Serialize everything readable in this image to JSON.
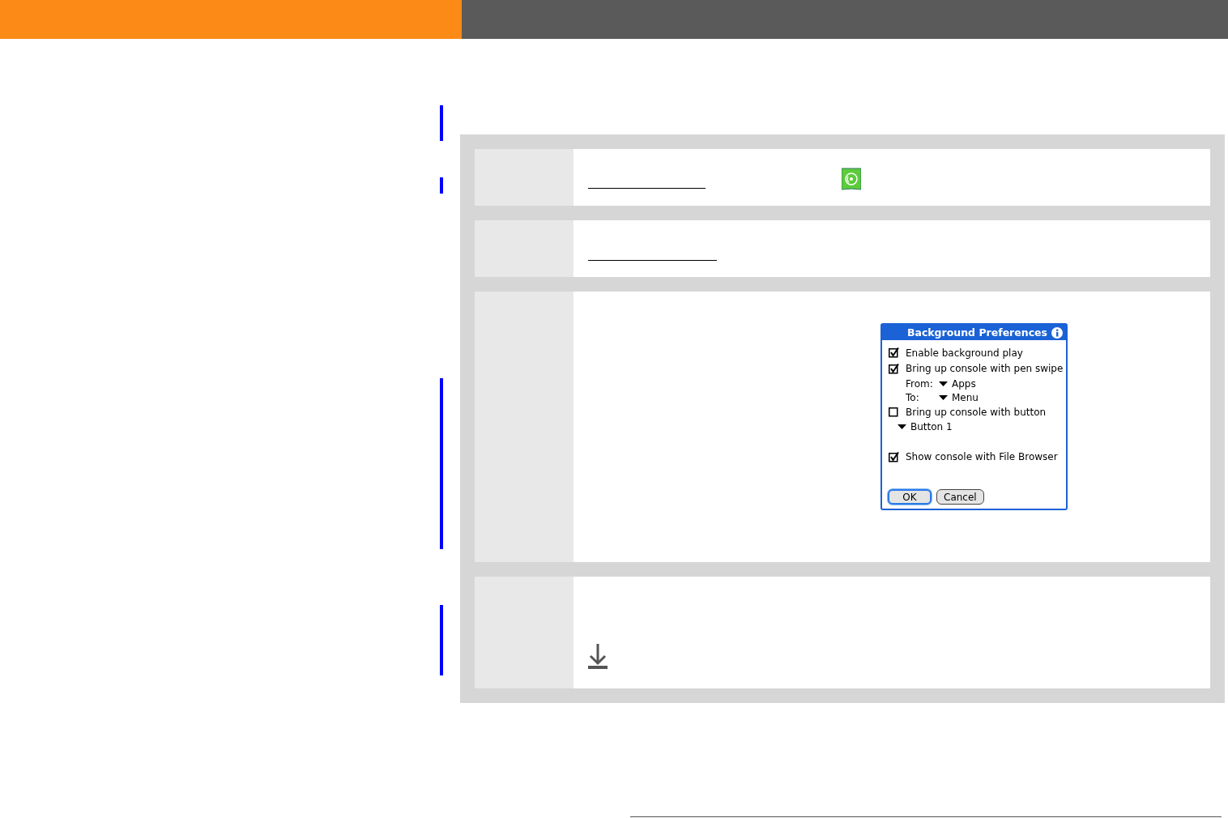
{
  "dialog": {
    "title": "Background Preferences",
    "items": [
      {
        "kind": "checkbox",
        "label": "Enable background play",
        "checked": true
      },
      {
        "kind": "checkbox",
        "label": "Bring up console with pen swipe",
        "checked": true
      },
      {
        "kind": "dropdown",
        "label": "From:",
        "value": "Apps"
      },
      {
        "kind": "dropdown",
        "label": "To:",
        "value": "Menu"
      },
      {
        "kind": "checkbox",
        "label": "Bring up console with button",
        "checked": false
      },
      {
        "kind": "dropdown",
        "value": "Button 1"
      },
      {
        "kind": "spacer"
      },
      {
        "kind": "checkbox",
        "label": "Show console with File Browser",
        "checked": true
      }
    ],
    "buttons": [
      {
        "label": "OK",
        "selected": true
      },
      {
        "label": "Cancel",
        "selected": false
      }
    ]
  }
}
